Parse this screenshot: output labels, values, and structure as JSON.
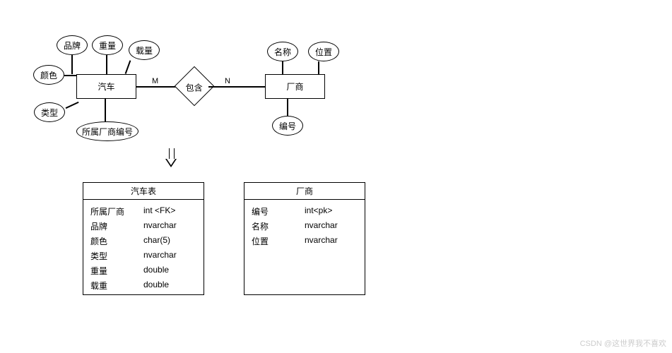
{
  "er": {
    "entities": {
      "car": "汽车",
      "vendor": "厂商"
    },
    "relationship": {
      "name": "包含",
      "left_card": "M",
      "right_card": "N"
    },
    "attributes": {
      "brand": "品牌",
      "weight": "重量",
      "payload": "载量",
      "color": "颜色",
      "type": "类型",
      "vendor_fk": "所属厂商编号",
      "vendor_name": "名称",
      "vendor_loc": "位置",
      "vendor_id": "编号"
    }
  },
  "tables": {
    "car": {
      "title": "汽车表",
      "rows": [
        {
          "name": "所属厂商",
          "type": "int",
          "flag": "<FK>"
        },
        {
          "name": "品牌",
          "type": "nvarchar",
          "flag": ""
        },
        {
          "name": "颜色",
          "type": "char(5)",
          "flag": ""
        },
        {
          "name": "类型",
          "type": "nvarchar",
          "flag": ""
        },
        {
          "name": "重量",
          "type": "double",
          "flag": ""
        },
        {
          "name": "载重",
          "type": "double",
          "flag": ""
        }
      ]
    },
    "vendor": {
      "title": "厂商",
      "rows": [
        {
          "name": "编号",
          "type": "int<pk>",
          "flag": ""
        },
        {
          "name": "名称",
          "type": "nvarchar",
          "flag": ""
        },
        {
          "name": "位置",
          "type": "nvarchar",
          "flag": ""
        }
      ]
    }
  },
  "watermark": "CSDN @这世界我不喜欢",
  "chart_data": {
    "type": "er-diagram",
    "entities": [
      {
        "name": "汽车",
        "attributes": [
          "品牌",
          "重量",
          "载量",
          "颜色",
          "类型",
          "所属厂商编号"
        ]
      },
      {
        "name": "厂商",
        "attributes": [
          "名称",
          "位置",
          "编号"
        ]
      }
    ],
    "relationships": [
      {
        "name": "包含",
        "between": [
          "汽车",
          "厂商"
        ],
        "cardinality": [
          "M",
          "N"
        ]
      }
    ],
    "schemas": [
      {
        "table": "汽车表",
        "columns": [
          {
            "name": "所属厂商",
            "type": "int",
            "key": "FK"
          },
          {
            "name": "品牌",
            "type": "nvarchar"
          },
          {
            "name": "颜色",
            "type": "char(5)"
          },
          {
            "name": "类型",
            "type": "nvarchar"
          },
          {
            "name": "重量",
            "type": "double"
          },
          {
            "name": "载重",
            "type": "double"
          }
        ]
      },
      {
        "table": "厂商",
        "columns": [
          {
            "name": "编号",
            "type": "int",
            "key": "pk"
          },
          {
            "name": "名称",
            "type": "nvarchar"
          },
          {
            "name": "位置",
            "type": "nvarchar"
          }
        ]
      }
    ]
  }
}
